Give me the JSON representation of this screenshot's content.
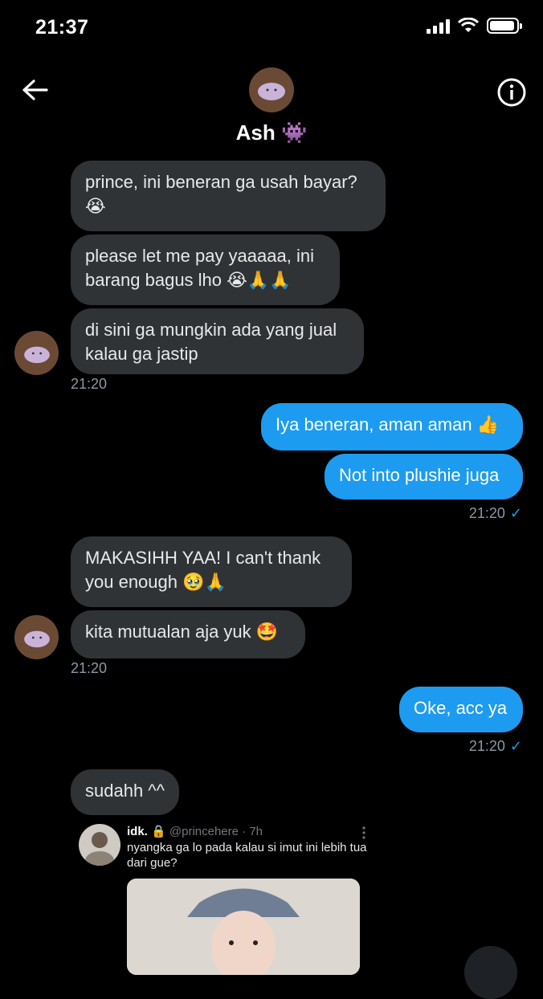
{
  "status_bar": {
    "time": "21:37"
  },
  "header": {
    "name": "Ash 👾"
  },
  "messages": {
    "m1": {
      "text": "prince, ini beneran ga usah bayar? 😭"
    },
    "m2": {
      "text": "please let me pay yaaaaa, ini barang bagus lho 😭🙏🙏"
    },
    "m3": {
      "text": "di sini ga mungkin ada yang jual kalau ga jastip"
    },
    "t1": "21:20",
    "m4": {
      "text": "Iya beneran, aman aman 👍"
    },
    "m5": {
      "text": "Not into plushie juga"
    },
    "t2": "21:20",
    "m6": {
      "text": "MAKASIHH YAA! I can't thank you enough 🥹🙏"
    },
    "m7": {
      "text": "kita mutualan aja yuk 🤩"
    },
    "t3": "21:20",
    "m8": {
      "text": "Oke, acc ya"
    },
    "t4": "21:20",
    "m9": {
      "text": "sudahh ^^"
    }
  },
  "tweet": {
    "name": "idk.",
    "handle": "@princehere",
    "time": "· 7h",
    "text": "nyangka ga lo pada kalau si imut ini lebih tua dari gue?"
  },
  "colors": {
    "outgoing": "#1d9bf0",
    "incoming": "#2f3336",
    "background": "#000000"
  }
}
